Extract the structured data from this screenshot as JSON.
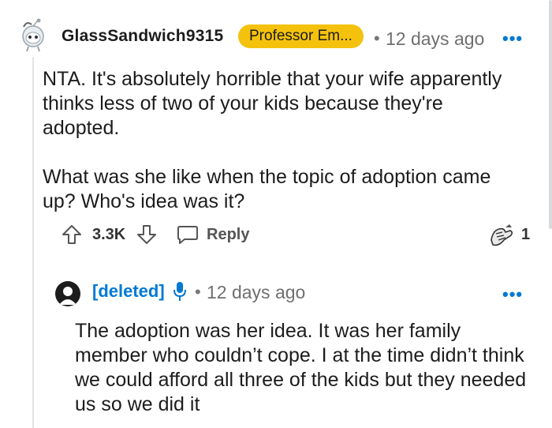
{
  "comment": {
    "author": "GlassSandwich9315",
    "flair": "Professor Em...",
    "separator": "•",
    "time": "12 days ago",
    "more": "•••",
    "paragraphs": [
      "NTA. It's absolutely horrible that your wife apparently thinks less of two of your kids because they're adopted.",
      "What was she like when the topic of adoption came up? Who's idea was it?"
    ],
    "vote_count": "3.3K",
    "reply_label": "Reply",
    "award_count": "1"
  },
  "reply": {
    "author": "[deleted]",
    "separator": "•",
    "time": "12 days ago",
    "more": "•••",
    "text": "The adoption was her idea. It was her family member who couldn’t cope. I at the time didn’t think we could afford all three of the kids but they needed us so we did it"
  },
  "colors": {
    "flair_bg": "#f4c20d",
    "link_blue": "#0079d3",
    "meta_gray": "#6f6f6f"
  },
  "icons": {
    "avatar": "snoo-avatar-icon",
    "upvote": "upvote-arrow-icon",
    "downvote": "downvote-arrow-icon",
    "reply": "chat-bubble-icon",
    "award": "award-hands-icon",
    "mic": "microphone-icon"
  }
}
